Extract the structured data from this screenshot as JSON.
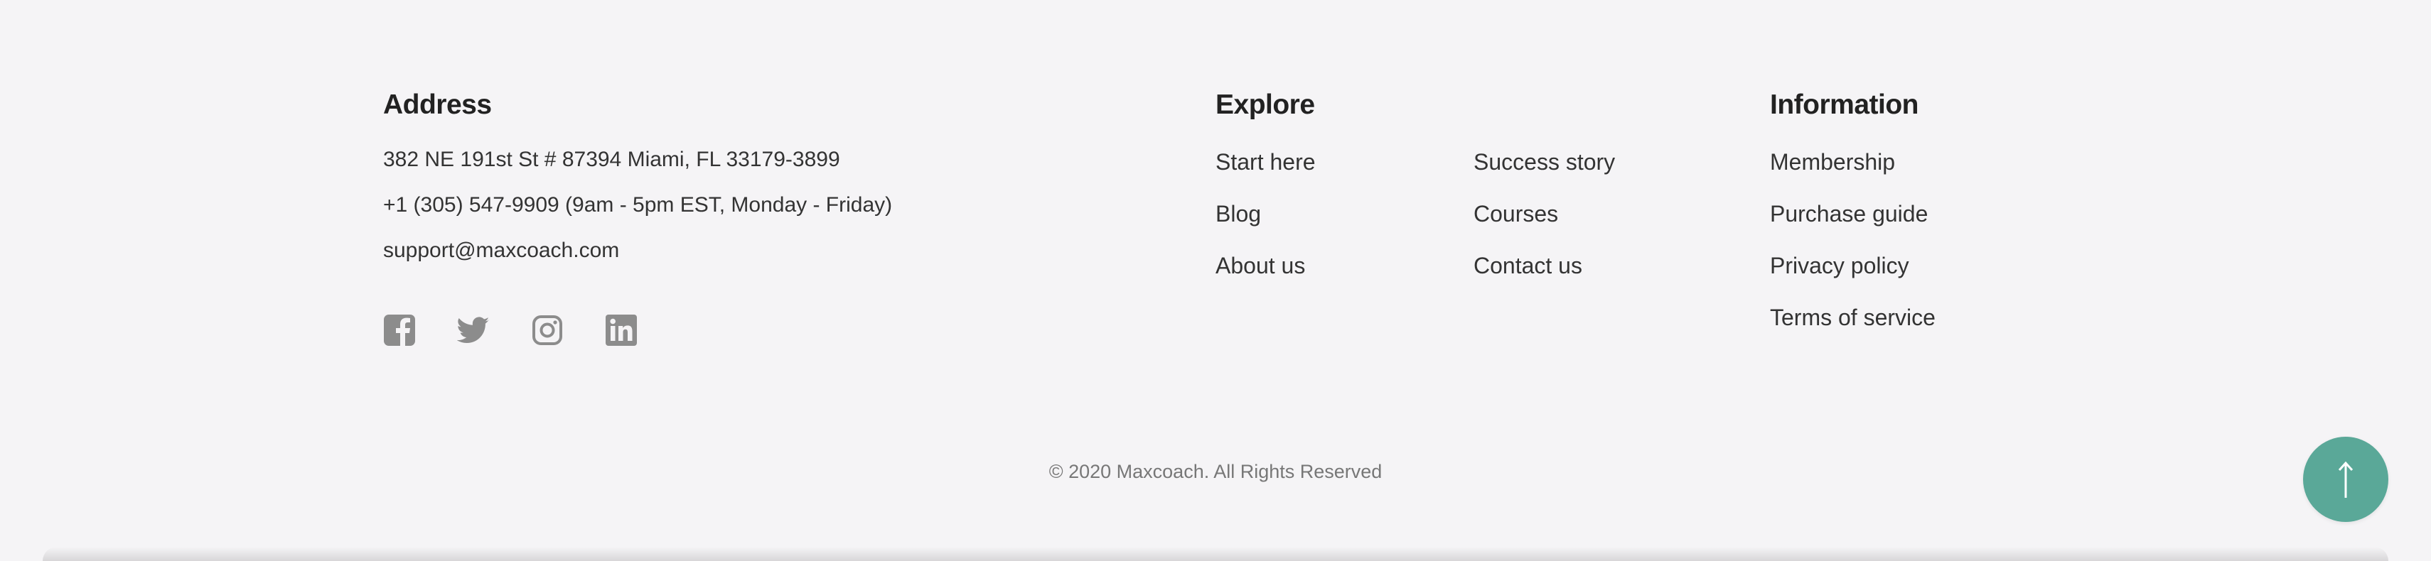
{
  "address": {
    "heading": "Address",
    "lines": [
      "382 NE 191st St # 87394 Miami, FL 33179-3899",
      "+1 (305) 547-9909 (9am - 5pm EST, Monday - Friday)",
      "support@maxcoach.com"
    ]
  },
  "social": {
    "icons": [
      "facebook-icon",
      "twitter-icon",
      "instagram-icon",
      "linkedin-icon"
    ],
    "icon_color": "#8c8c8c"
  },
  "explore": {
    "heading": "Explore",
    "col1": [
      "Start here",
      "Blog",
      "About us"
    ],
    "col2": [
      "Success story",
      "Courses",
      "Contact us"
    ]
  },
  "information": {
    "heading": "Information",
    "links": [
      "Membership",
      "Purchase guide",
      "Privacy policy",
      "Terms of service"
    ]
  },
  "copyright": "© 2020 Maxcoach. All Rights Reserved",
  "back_to_top": {
    "icon": "arrow-up-icon",
    "color": "#5aa898"
  }
}
